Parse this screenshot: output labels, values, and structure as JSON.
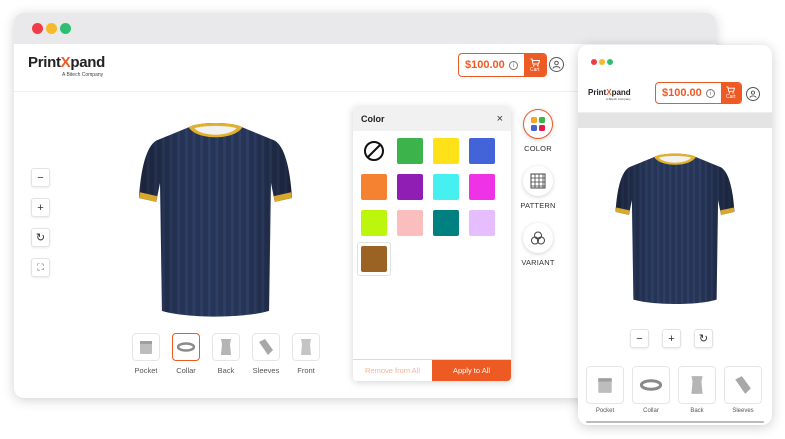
{
  "brand": {
    "name_prefix": "Print",
    "name_x": "X",
    "name_suffix": "pand",
    "tagline": "A Bitech Company",
    "accent": "#ee5a24"
  },
  "header": {
    "price": "$100.00",
    "info_glyph": "i",
    "cart_label": "Cart"
  },
  "zoom_controls": [
    {
      "name": "zoom-out-button",
      "glyph": "−"
    },
    {
      "name": "zoom-in-button",
      "glyph": "+"
    },
    {
      "name": "rotate-button",
      "glyph": "↻"
    },
    {
      "name": "fullscreen-button",
      "glyph": "⛶"
    }
  ],
  "views": [
    {
      "label": "Pocket",
      "active": false
    },
    {
      "label": "Collar",
      "active": true
    },
    {
      "label": "Back",
      "active": false
    },
    {
      "label": "Sleeves",
      "active": false
    },
    {
      "label": "Front",
      "active": false
    }
  ],
  "color_panel": {
    "title": "Color",
    "close_glyph": "×",
    "swatches": [
      "none",
      "#3cb44b",
      "#ffe119",
      "#4363d8",
      "#f58231",
      "#911eb4",
      "#46f0f0",
      "#f032e6",
      "#bcf60c",
      "#fabebe",
      "#008080",
      "#e6beff",
      "#9a6324"
    ],
    "selected": "#9a6324",
    "remove_label": "Remove from All",
    "apply_label": "Apply to All"
  },
  "tools": [
    {
      "label": "COLOR",
      "icon": "palette-icon",
      "active": true
    },
    {
      "label": "PATTERN",
      "icon": "pattern-icon",
      "active": false
    },
    {
      "label": "VARIANT",
      "icon": "variant-icon",
      "active": false
    }
  ],
  "mobile": {
    "views": [
      {
        "label": "Pocket"
      },
      {
        "label": "Collar"
      },
      {
        "label": "Back"
      },
      {
        "label": "Sleeves"
      }
    ]
  }
}
